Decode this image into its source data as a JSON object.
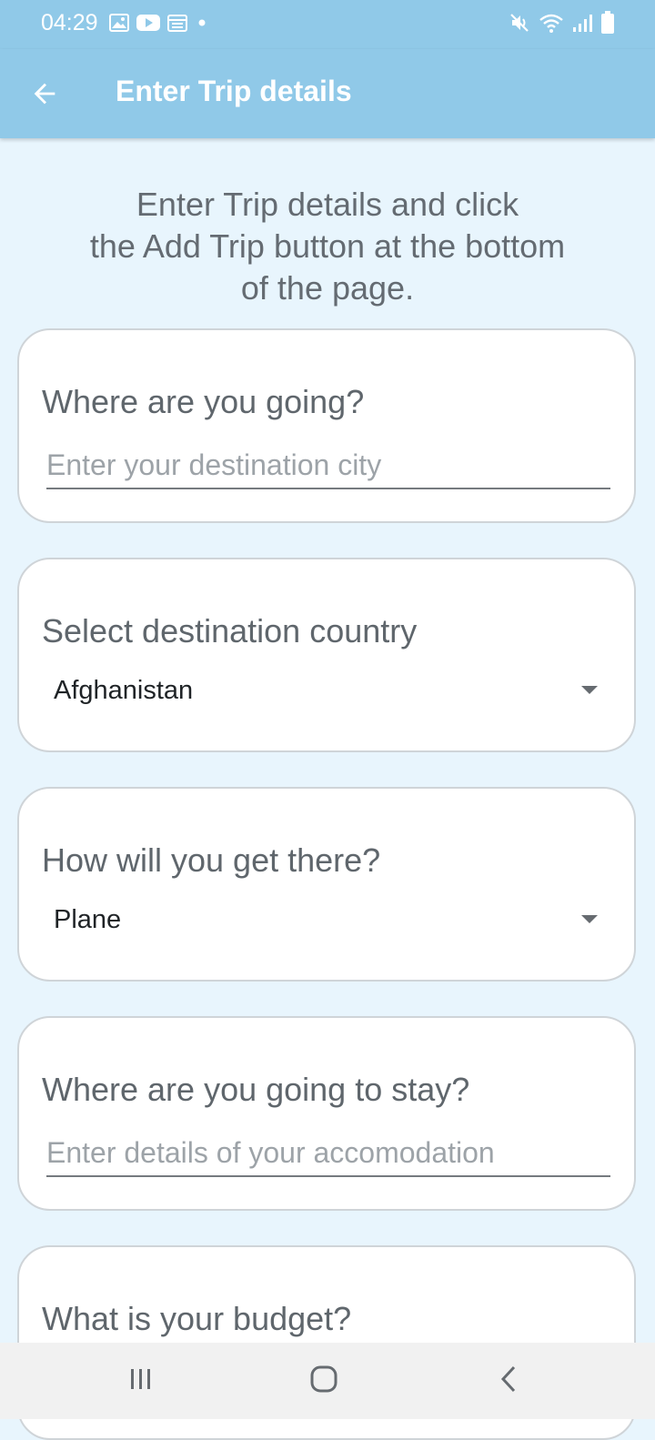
{
  "status_bar": {
    "time": "04:29",
    "left_icons": [
      "gallery-icon",
      "youtube-icon",
      "calendar-icon",
      "dot-icon"
    ],
    "right_icons": [
      "mute-icon",
      "wifi-icon",
      "signal-icon",
      "battery-icon"
    ]
  },
  "app_bar": {
    "title": "Enter Trip details",
    "back_icon": "arrow-back-icon"
  },
  "intro_text": "Enter Trip details and click\nthe Add Trip button at the bottom\nof the page.",
  "form": {
    "destination_city": {
      "label": "Where are you going?",
      "placeholder": "Enter your destination city",
      "value": ""
    },
    "destination_country": {
      "label": "Select destination country",
      "selected": "Afghanistan"
    },
    "transport": {
      "label": "How will you get there?",
      "selected": "Plane"
    },
    "accommodation": {
      "label": "Where are you going to stay?",
      "placeholder": "Enter details of your accomodation",
      "value": ""
    },
    "budget": {
      "label": "What is your budget?"
    }
  },
  "nav_bar": {
    "recents_icon": "recents-icon",
    "home_icon": "home-icon",
    "back_icon": "back-icon"
  },
  "colors": {
    "app_bar": "#90c9e8",
    "background": "#e8f5fd",
    "card": "#ffffff",
    "nav_bar": "#f1f1f1"
  }
}
